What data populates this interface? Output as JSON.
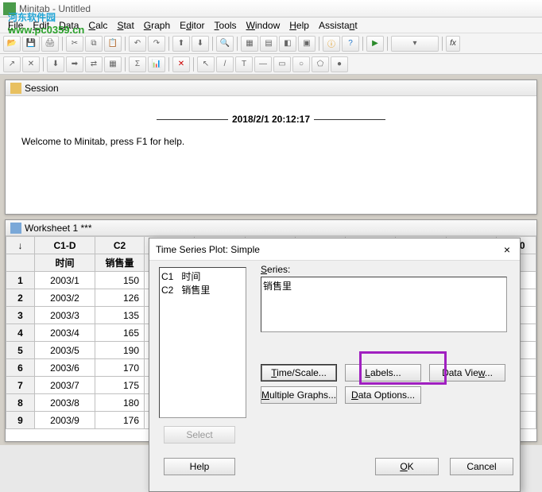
{
  "window": {
    "title": "Minitab - Untitled"
  },
  "watermark": {
    "line1": "河东软件园",
    "line2": "www.pc0359.cn"
  },
  "menu": {
    "file": "File",
    "edit": "Edit",
    "data": "Data",
    "calc": "Calc",
    "stat": "Stat",
    "graph": "Graph",
    "editor": "Editor",
    "tools": "Tools",
    "window": "Window",
    "help": "Help",
    "assistant": "Assistant"
  },
  "session": {
    "title": "Session",
    "timestamp": "2018/2/1 20:12:17",
    "welcome": "Welcome to Minitab, press F1 for help."
  },
  "worksheet": {
    "title": "Worksheet 1 ***",
    "cols": {
      "arrow": "↓",
      "c1": "C1-D",
      "c2": "C2",
      "c10": "C10"
    },
    "headers": {
      "h1": "时间",
      "h2": "销售量"
    },
    "rows": [
      {
        "n": "1",
        "a": "2003/1",
        "b": "150"
      },
      {
        "n": "2",
        "a": "2003/2",
        "b": "126"
      },
      {
        "n": "3",
        "a": "2003/3",
        "b": "135"
      },
      {
        "n": "4",
        "a": "2003/4",
        "b": "165"
      },
      {
        "n": "5",
        "a": "2003/5",
        "b": "190"
      },
      {
        "n": "6",
        "a": "2003/6",
        "b": "170"
      },
      {
        "n": "7",
        "a": "2003/7",
        "b": "175"
      },
      {
        "n": "8",
        "a": "2003/8",
        "b": "180"
      },
      {
        "n": "9",
        "a": "2003/9",
        "b": "176"
      }
    ]
  },
  "dialog": {
    "title": "Time Series Plot: Simple",
    "close": "×",
    "varlist": {
      "l1": "C1   时间",
      "l2": "C2   销售里"
    },
    "series_label": "Series:",
    "series_value": "销售里",
    "btn_time": "Time/Scale...",
    "btn_labels": "Labels...",
    "btn_dataview": "Data View...",
    "btn_multiple": "Multiple Graphs...",
    "btn_dataopt": "Data Options...",
    "btn_select": "Select",
    "btn_help": "Help",
    "btn_ok": "OK",
    "btn_cancel": "Cancel"
  }
}
